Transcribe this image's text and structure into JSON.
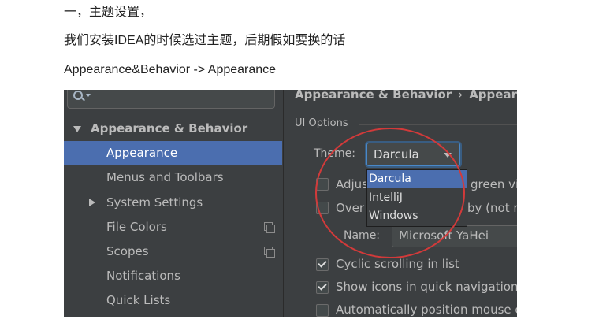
{
  "article": {
    "heading": "一，主题设置，",
    "intro": "我们安装IDEA的时候选过主题，后期假如要换的话",
    "path": "Appearance&Behavior -> Appearance"
  },
  "settings": {
    "breadcrumb": [
      "Appearance & Behavior",
      "Appearan"
    ],
    "breadcrumb_separator": "›",
    "tree": [
      {
        "label": "Appearance & Behavior",
        "expanded": true,
        "bold": true
      },
      {
        "label": "Appearance",
        "selected": true
      },
      {
        "label": "Menus and Toolbars"
      },
      {
        "label": "System Settings",
        "collapsed": true
      },
      {
        "label": "File Colors",
        "copy_icon": true
      },
      {
        "label": "Scopes",
        "copy_icon": true
      },
      {
        "label": "Notifications"
      },
      {
        "label": "Quick Lists"
      }
    ],
    "group_title": "UI Options",
    "theme_label": "Theme:",
    "theme_value": "Darcula",
    "theme_options": [
      "Darcula",
      "IntelliJ",
      "Windows"
    ],
    "theme_highlighted": "Darcula",
    "checkboxes": [
      {
        "label": "Adjus",
        "tail": "green visi",
        "checked": false
      },
      {
        "label": "Over",
        "tail": "by (not re",
        "checked": false
      },
      {
        "label": "Cyclic scrolling in list",
        "checked": true
      },
      {
        "label": "Show icons in quick navigation",
        "checked": true
      },
      {
        "label": "Automatically position mouse cu",
        "checked": false
      }
    ],
    "font_name_label": "Name:",
    "font_name_value": "Microsoft YaHei"
  },
  "colors": {
    "panel_bg": "#3c3f41",
    "selection": "#4b6eaf",
    "annotation": "#d23a3a"
  }
}
